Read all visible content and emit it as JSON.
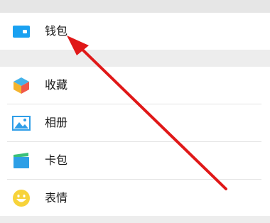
{
  "menu": {
    "wallet": {
      "label": "钱包",
      "icon": "wallet-icon",
      "color": "#1aa1f1"
    },
    "items": [
      {
        "label": "收藏",
        "icon": "favorites-cube-icon"
      },
      {
        "label": "相册",
        "icon": "album-image-icon"
      },
      {
        "label": "卡包",
        "icon": "card-wallet-icon"
      },
      {
        "label": "表情",
        "icon": "sticker-smiley-icon"
      }
    ]
  },
  "annotation": {
    "arrow_color": "#e01818",
    "points_to": "wallet"
  }
}
